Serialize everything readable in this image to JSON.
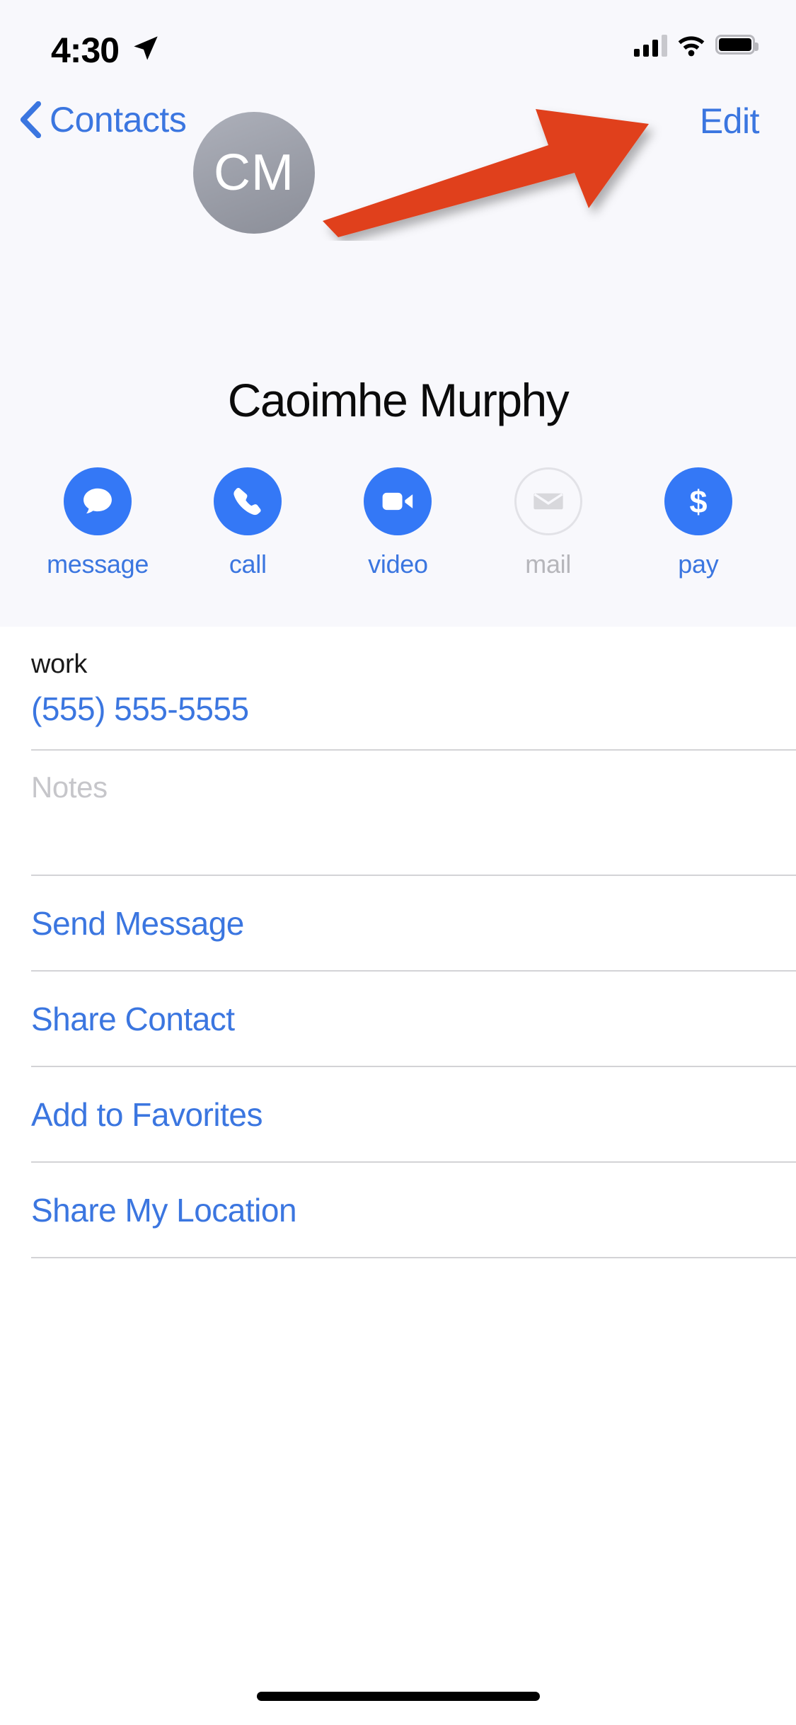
{
  "status_bar": {
    "time": "4:30",
    "location_icon": "location-arrow-icon",
    "signal_icon": "cellular-bars-icon",
    "wifi_icon": "wifi-icon",
    "battery_icon": "battery-icon"
  },
  "nav": {
    "back_label": "Contacts",
    "back_icon": "chevron-left-icon",
    "edit_label": "Edit"
  },
  "contact": {
    "initials": "CM",
    "name": "Caoimhe Murphy"
  },
  "actions": [
    {
      "label": "message",
      "icon": "message-bubble-icon",
      "enabled": true
    },
    {
      "label": "call",
      "icon": "phone-icon",
      "enabled": true
    },
    {
      "label": "video",
      "icon": "video-camera-icon",
      "enabled": true
    },
    {
      "label": "mail",
      "icon": "envelope-icon",
      "enabled": false
    },
    {
      "label": "pay",
      "icon": "dollar-sign-icon",
      "enabled": true
    }
  ],
  "details": {
    "phone_label": "work",
    "phone_value": "(555) 555-5555",
    "notes_placeholder": "Notes"
  },
  "list_actions": [
    {
      "label": "Send Message"
    },
    {
      "label": "Share Contact"
    },
    {
      "label": "Add to Favorites"
    },
    {
      "label": "Share My Location"
    }
  ],
  "annotation": {
    "arrow_icon": "annotation-arrow-icon",
    "color": "#e0401f",
    "points_at": "Edit"
  },
  "colors": {
    "accent_blue": "#3b76e0",
    "button_blue": "#3478f6",
    "hero_bg": "#f8f8fc",
    "sheet_bg": "#ffffff",
    "disabled_gray": "#b6b6bb",
    "avatar_gray": "#9a9da7"
  }
}
